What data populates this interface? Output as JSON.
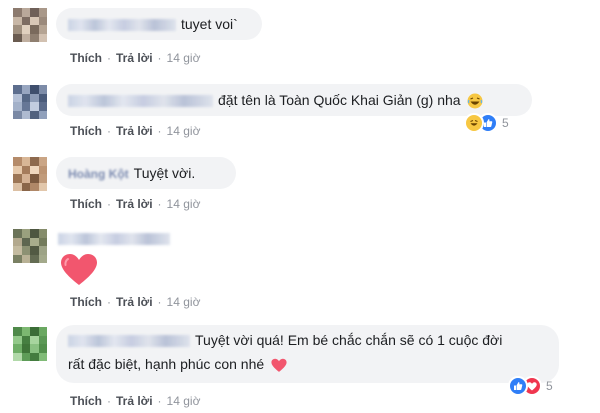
{
  "icons": {
    "haha": "haha-reaction-icon",
    "like": "like-reaction-icon",
    "love": "love-reaction-icon"
  },
  "colors": {
    "like": "#2f7ef7",
    "love": "#f0364f",
    "haha": "#f7c742",
    "bubble": "#f2f3f5",
    "action": "#4b4f56"
  },
  "comments": [
    {
      "text": "tuyet voi`",
      "actions": {
        "like": "Thích",
        "reply": "Trả lời",
        "time": "14 giờ"
      }
    },
    {
      "text": "đặt tên là Toàn Quốc Khai Giản (g) nha",
      "reactions": {
        "count": "5"
      },
      "actions": {
        "like": "Thích",
        "reply": "Trả lời",
        "time": "14 giờ"
      }
    },
    {
      "name": "Hoàng Kột",
      "text": "Tuyệt vời.",
      "actions": {
        "like": "Thích",
        "reply": "Trả lời",
        "time": "14 giờ"
      }
    },
    {
      "text": "",
      "actions": {
        "like": "Thích",
        "reply": "Trả lời",
        "time": "14 giờ"
      }
    },
    {
      "text_line1": "Tuyệt vời quá! Em bé chắc chắn sẽ có 1 cuộc đời",
      "text_line2": "rất đặc biệt, hạnh phúc con nhé",
      "reactions": {
        "count": "5"
      },
      "actions": {
        "like": "Thích",
        "reply": "Trả lời",
        "time": "14 giờ"
      }
    }
  ]
}
